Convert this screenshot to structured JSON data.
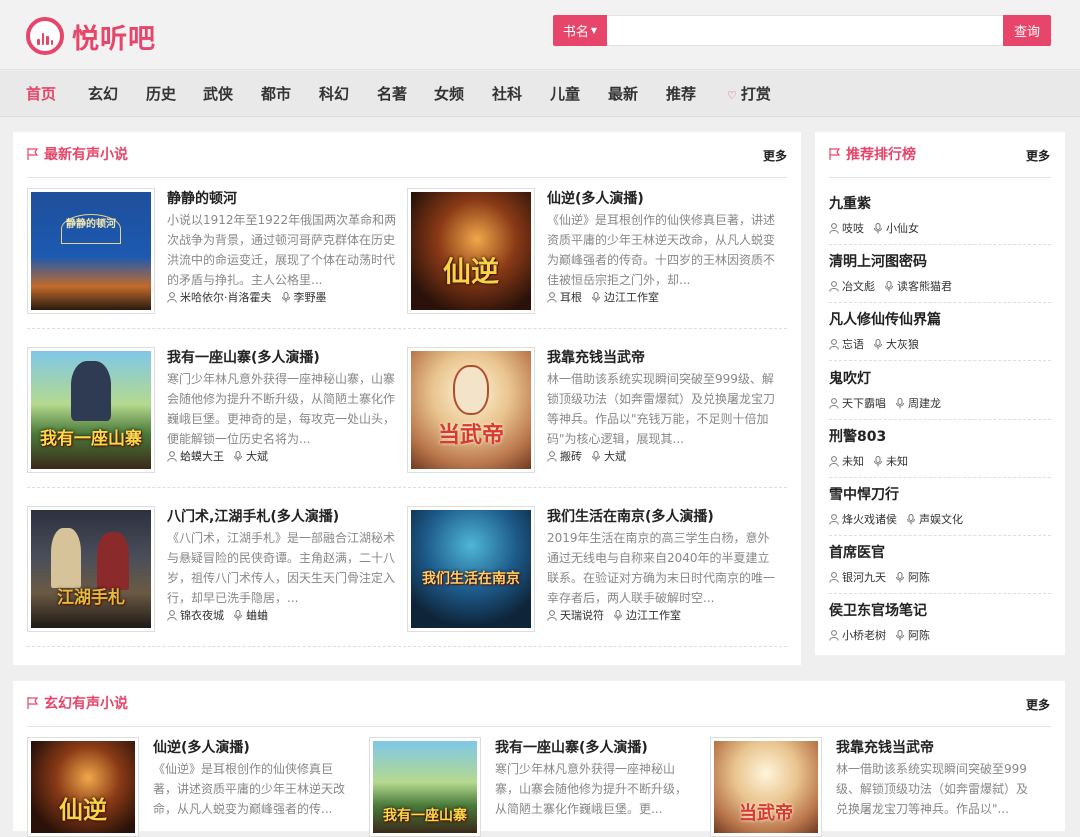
{
  "brand": {
    "name": "悦听吧",
    "color": "#e7466a"
  },
  "search": {
    "type_label": "书名",
    "placeholder": "",
    "button_label": "查询"
  },
  "nav": [
    {
      "label": "首页",
      "active": true
    },
    {
      "label": "玄幻"
    },
    {
      "label": "历史"
    },
    {
      "label": "武侠"
    },
    {
      "label": "都市"
    },
    {
      "label": "科幻"
    },
    {
      "label": "名著"
    },
    {
      "label": "女频"
    },
    {
      "label": "社科"
    },
    {
      "label": "儿童"
    },
    {
      "label": "最新"
    },
    {
      "label": "推荐"
    },
    {
      "label": "打赏",
      "icon": "heart-icon"
    }
  ],
  "latest": {
    "title": "最新有声小说",
    "more": "更多",
    "books": [
      {
        "title": "静静的顿河",
        "desc": "小说以1912年至1922年俄国两次革命和两次战争为背景，通过顿河哥萨克群体在历史洪流中的命运变迁，展现了个体在动荡时代的矛盾与挣扎。主人公格里...",
        "author": "米哈依尔·肖洛霍夫",
        "narrator": "李野墨",
        "cover_text": "静静的顿河"
      },
      {
        "title": "仙逆(多人演播)",
        "desc": "《仙逆》是耳根创作的仙侠修真巨著，讲述资质平庸的少年王林逆天改命，从凡人蜕变为巅峰强者的传奇。十四岁的王林因资质不佳被恒岳宗拒之门外，却...",
        "author": "耳根",
        "narrator": "边江工作室",
        "cover_text": "仙逆"
      },
      {
        "title": "我有一座山寨(多人演播)",
        "desc": "寒门少年林凡意外获得一座神秘山寨，山寨会随他修为提升不断升级，从简陋土寨化作巍峨巨堡。更神奇的是，每攻克一处山头，便能解锁一位历史名将为...",
        "author": "蛤蟆大王",
        "narrator": "大斌",
        "cover_text": "我有一座山寨"
      },
      {
        "title": "我靠充钱当武帝",
        "desc": "林一借助该系统实现瞬间突破至999级、解锁顶级功法（如奔雷爆弑）及兑换屠龙宝刀等神兵。作品以\"充钱万能，不足则十倍加码\"为核心逻辑，展现其...",
        "author": "搬砖",
        "narrator": "大斌",
        "cover_text": "当武帝"
      },
      {
        "title": "八门术,江湖手札(多人演播)",
        "desc": "《八门术，江湖手札》是一部融合江湖秘术与悬疑冒险的民侠奇谭。主角赵满，二十八岁，祖传八门术传人，因天生天门骨注定入行，却早已洗手隐居，...",
        "author": "锦衣夜城",
        "narrator": "蛐蛐",
        "cover_text": "江湖手札"
      },
      {
        "title": "我们生活在南京(多人演播)",
        "desc": "2019年生活在南京的高三学生白杨，意外通过无线电与自称来自2040年的半夏建立联系。在验证对方确为末日时代南京的唯一幸存者后，两人联手破解时空...",
        "author": "天瑞说符",
        "narrator": "边江工作室",
        "cover_text": "我们生活在南京"
      }
    ]
  },
  "ranking": {
    "title": "推荐排行榜",
    "more": "更多",
    "items": [
      {
        "title": "九重紫",
        "author": "吱吱",
        "narrator": "小仙女"
      },
      {
        "title": "清明上河图密码",
        "author": "冶文彪",
        "narrator": "读客熊猫君"
      },
      {
        "title": "凡人修仙传仙界篇",
        "author": "忘语",
        "narrator": "大灰狼"
      },
      {
        "title": "鬼吹灯",
        "author": "天下霸唱",
        "narrator": "周建龙"
      },
      {
        "title": "刑警803",
        "author": "未知",
        "narrator": "未知"
      },
      {
        "title": "雪中悍刀行",
        "author": "烽火戏诸侯",
        "narrator": "声娱文化"
      },
      {
        "title": "首席医官",
        "author": "银河九天",
        "narrator": "阿陈"
      },
      {
        "title": "侯卫东官场笔记",
        "author": "小桥老树",
        "narrator": "阿陈"
      }
    ]
  },
  "fantasy": {
    "title": "玄幻有声小说",
    "more": "更多",
    "books": [
      {
        "title": "仙逆(多人演播)",
        "desc": "《仙逆》是耳根创作的仙侠修真巨著，讲述资质平庸的少年王林逆天改命，从凡人蜕变为巅峰强者的传...",
        "cover_text": "仙逆"
      },
      {
        "title": "我有一座山寨(多人演播)",
        "desc": "寒门少年林凡意外获得一座神秘山寨，山寨会随他修为提升不断升级，从简陋土寨化作巍峨巨堡。更...",
        "cover_text": "我有一座山寨"
      },
      {
        "title": "我靠充钱当武帝",
        "desc": "林一借助该系统实现瞬间突破至999级、解锁顶级功法（如奔雷爆弑）及兑换屠龙宝刀等神兵。作品以\"...",
        "cover_text": "当武帝"
      }
    ]
  }
}
